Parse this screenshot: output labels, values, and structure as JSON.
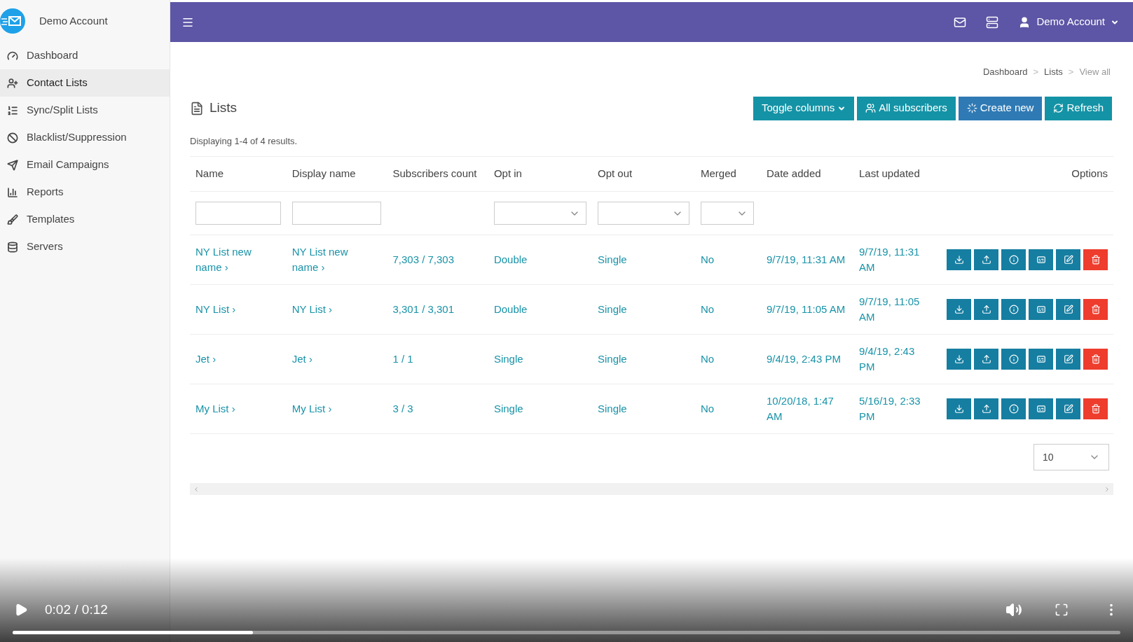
{
  "sidebar": {
    "account": "Demo Account",
    "items": [
      {
        "label": "Dashboard",
        "selected": false
      },
      {
        "label": "Contact Lists",
        "selected": true
      },
      {
        "label": "Sync/Split Lists",
        "selected": false
      },
      {
        "label": "Blacklist/Suppression",
        "selected": false
      },
      {
        "label": "Email Campaigns",
        "selected": false
      },
      {
        "label": "Reports",
        "selected": false
      },
      {
        "label": "Templates",
        "selected": false
      },
      {
        "label": "Servers",
        "selected": false
      }
    ]
  },
  "header": {
    "user": "Demo Account"
  },
  "breadcrumbs": [
    {
      "label": "Dashboard",
      "kind": "link"
    },
    {
      "label": ">",
      "kind": "sep"
    },
    {
      "label": "Lists",
      "kind": "link"
    },
    {
      "label": ">",
      "kind": "sep"
    },
    {
      "label": "View all",
      "kind": "current"
    }
  ],
  "page_title": "Lists",
  "actions": [
    {
      "label": "Toggle columns",
      "kind": "dropdown"
    },
    {
      "label": "All subscribers",
      "kind": "users"
    },
    {
      "label": "Create new",
      "kind": "create"
    },
    {
      "label": "Refresh",
      "kind": "refresh"
    }
  ],
  "summary": "Displaying 1-4 of 4 results.",
  "table": {
    "columns": [
      "Name",
      "Display name",
      "Subscribers count",
      "Opt in",
      "Opt out",
      "Merged",
      "Date added",
      "Last updated",
      "Options"
    ],
    "rows": [
      {
        "name": "NY List new name ›",
        "display_name": "NY List new name ›",
        "subscribers": "7,303 / 7,303",
        "opt_in": "Double",
        "opt_out": "Single",
        "merged": "No",
        "date_added": "9/7/19, 11:31 AM",
        "last_updated": "9/7/19, 11:31 AM"
      },
      {
        "name": "NY List ›",
        "display_name": "NY List ›",
        "subscribers": "3,301 / 3,301",
        "opt_in": "Double",
        "opt_out": "Single",
        "merged": "No",
        "date_added": "9/7/19, 11:05 AM",
        "last_updated": "9/7/19, 11:05 AM"
      },
      {
        "name": "Jet ›",
        "display_name": "Jet ›",
        "subscribers": "1 / 1",
        "opt_in": "Single",
        "opt_out": "Single",
        "merged": "No",
        "date_added": "9/4/19, 2:43 PM",
        "last_updated": "9/4/19, 2:43 PM"
      },
      {
        "name": "My List ›",
        "display_name": "My List ›",
        "subscribers": "3 / 3",
        "opt_in": "Single",
        "opt_out": "Single",
        "merged": "No",
        "date_added": "10/20/18, 1:47 AM",
        "last_updated": "5/16/19, 2:33 PM"
      }
    ]
  },
  "page_size": {
    "value": "10"
  },
  "video": {
    "time": "0:02 / 0:12",
    "level": 0.217
  }
}
